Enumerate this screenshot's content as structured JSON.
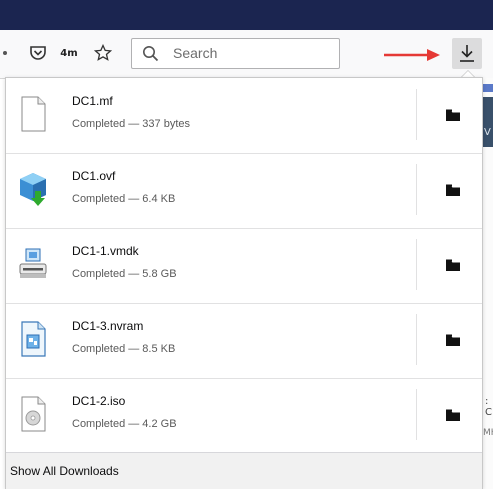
{
  "toolbar": {
    "pocket_icon": "pocket-icon",
    "extension_badge": "4m",
    "bookmark_icon": "star-icon",
    "search": {
      "placeholder": "Search",
      "icon": "search-icon"
    },
    "annotation": "red-arrow",
    "downloads_button_icon": "download-arrow-icon"
  },
  "downloads": {
    "items": [
      {
        "filename": "DC1.mf",
        "status": "Completed — 337 bytes",
        "icon": "generic-file-icon"
      },
      {
        "filename": "DC1.ovf",
        "status": "Completed — 6.4 KB",
        "icon": "ovf-package-icon"
      },
      {
        "filename": "DC1-1.vmdk",
        "status": "Completed — 5.8 GB",
        "icon": "vmdk-disk-icon"
      },
      {
        "filename": "DC1-3.nvram",
        "status": "Completed — 8.5 KB",
        "icon": "nvram-file-icon"
      },
      {
        "filename": "DC1-2.iso",
        "status": "Completed — 4.2 GB",
        "icon": "iso-disc-icon"
      }
    ],
    "show_all_label": "Show All Downloads"
  },
  "background_page": {
    "fragment_1": "V",
    "fragment_2": ": C",
    "fragment_3": "MH"
  },
  "colors": {
    "title_bar": "#1b2550",
    "toolbar_bg": "#f9f9fa",
    "annotation_arrow": "#e53935",
    "footer_bg": "#f1f1f1"
  }
}
